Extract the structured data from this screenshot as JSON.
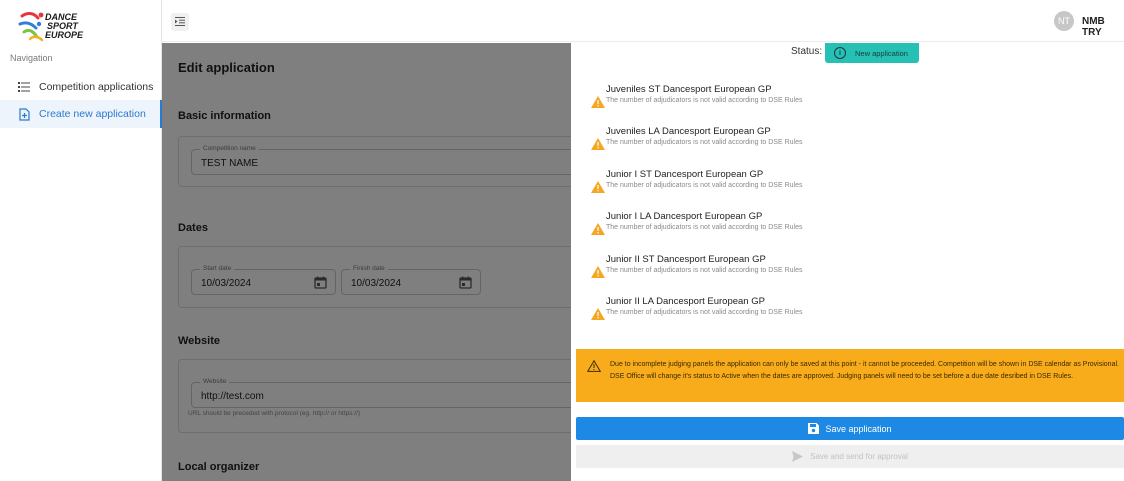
{
  "brand": {
    "logo_line1": "DANCE",
    "logo_line2": "SPORT",
    "logo_line3": "EUROPE"
  },
  "sidebar": {
    "heading": "Navigation",
    "items": [
      {
        "label": "Competition applications",
        "icon": "list-icon",
        "active": false
      },
      {
        "label": "Create new application",
        "icon": "add-document-icon",
        "active": true
      }
    ]
  },
  "header": {
    "avatar_initials": "NT",
    "username": "NMB TRY",
    "menu_icon": "indent-menu-icon"
  },
  "form": {
    "page_title": "Edit application",
    "basic_info": {
      "title": "Basic information",
      "competition_name_label": "Competition name",
      "competition_name_value": "TEST NAME"
    },
    "dates": {
      "title": "Dates",
      "start_label": "Start date",
      "start_value": "10/03/2024",
      "finish_label": "Finish date",
      "finish_value": "10/03/2024"
    },
    "website": {
      "title": "Website",
      "label": "Website",
      "value": "http://test.com",
      "helper": "URL should be preceded with protocol (eg. http:// or https://)"
    },
    "local_organizer": {
      "title": "Local organizer"
    }
  },
  "drawer": {
    "status_label": "Status:",
    "status_value": "New application",
    "status_color": "#26c1b4",
    "warnings": [
      {
        "title": "Juveniles ST Dancesport European GP",
        "message": "The number of adjudicators is not valid according to DSE Rules"
      },
      {
        "title": "Juveniles LA Dancesport European GP",
        "message": "The number of adjudicators is not valid according to DSE Rules"
      },
      {
        "title": "Junior I ST Dancesport European GP",
        "message": "The number of adjudicators is not valid according to DSE Rules"
      },
      {
        "title": "Junior I LA Dancesport European GP",
        "message": "The number of adjudicators is not valid according to DSE Rules"
      },
      {
        "title": "Junior II ST Dancesport European GP",
        "message": "The number of adjudicators is not valid according to DSE Rules"
      },
      {
        "title": "Junior II LA Dancesport European GP",
        "message": "The number of adjudicators is not valid according to DSE Rules"
      }
    ],
    "alert_text": "Due to incomplete judging panels the application can only be saved at this point - it cannot be proceeded. Competition will be shown in DSE calendar as Provisional. DSE Office will change it's status to Active when the dates are approved. Judging panels will need to be set before a due date desribed in DSE Rules.",
    "alert_color": "#f8ac1b",
    "save_label": "Save application",
    "send_label": "Save and send for approval"
  }
}
